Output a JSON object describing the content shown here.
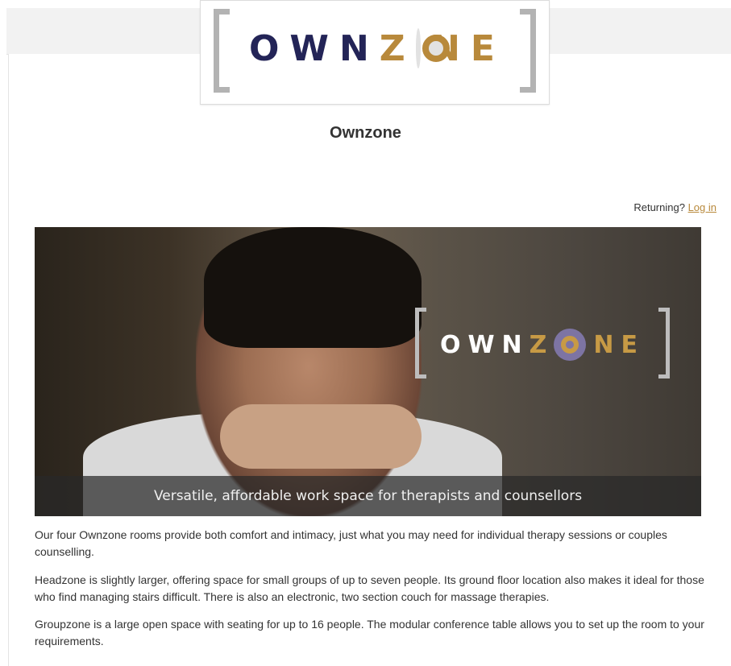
{
  "logo": {
    "text_own": "OWN",
    "text_z": "Z",
    "text_ne": "NE"
  },
  "site": {
    "title": "Ownzone"
  },
  "auth": {
    "prompt": "Returning?",
    "login_link": "Log in"
  },
  "hero": {
    "logo_own": "OWN",
    "logo_z": "Z",
    "logo_ne": "NE",
    "caption": "Versatile, affordable work space for therapists and counsellors"
  },
  "content": {
    "paragraphs": [
      "Our four Ownzone rooms provide both comfort and intimacy, just what you may need for individual therapy sessions or couples counselling.",
      "Headzone is slightly larger, offering space for small groups of up to seven people. Its ground floor location also makes it ideal for those who find managing stairs difficult. There is also an electronic, two section couch for massage therapies.",
      "Groupzone is a large open space with seating for up to 16 people. The modular conference table allows you to set up the room to your requirements."
    ]
  },
  "colors": {
    "brand_navy": "#232457",
    "brand_gold": "#b8893b",
    "link": "#b8893b"
  }
}
